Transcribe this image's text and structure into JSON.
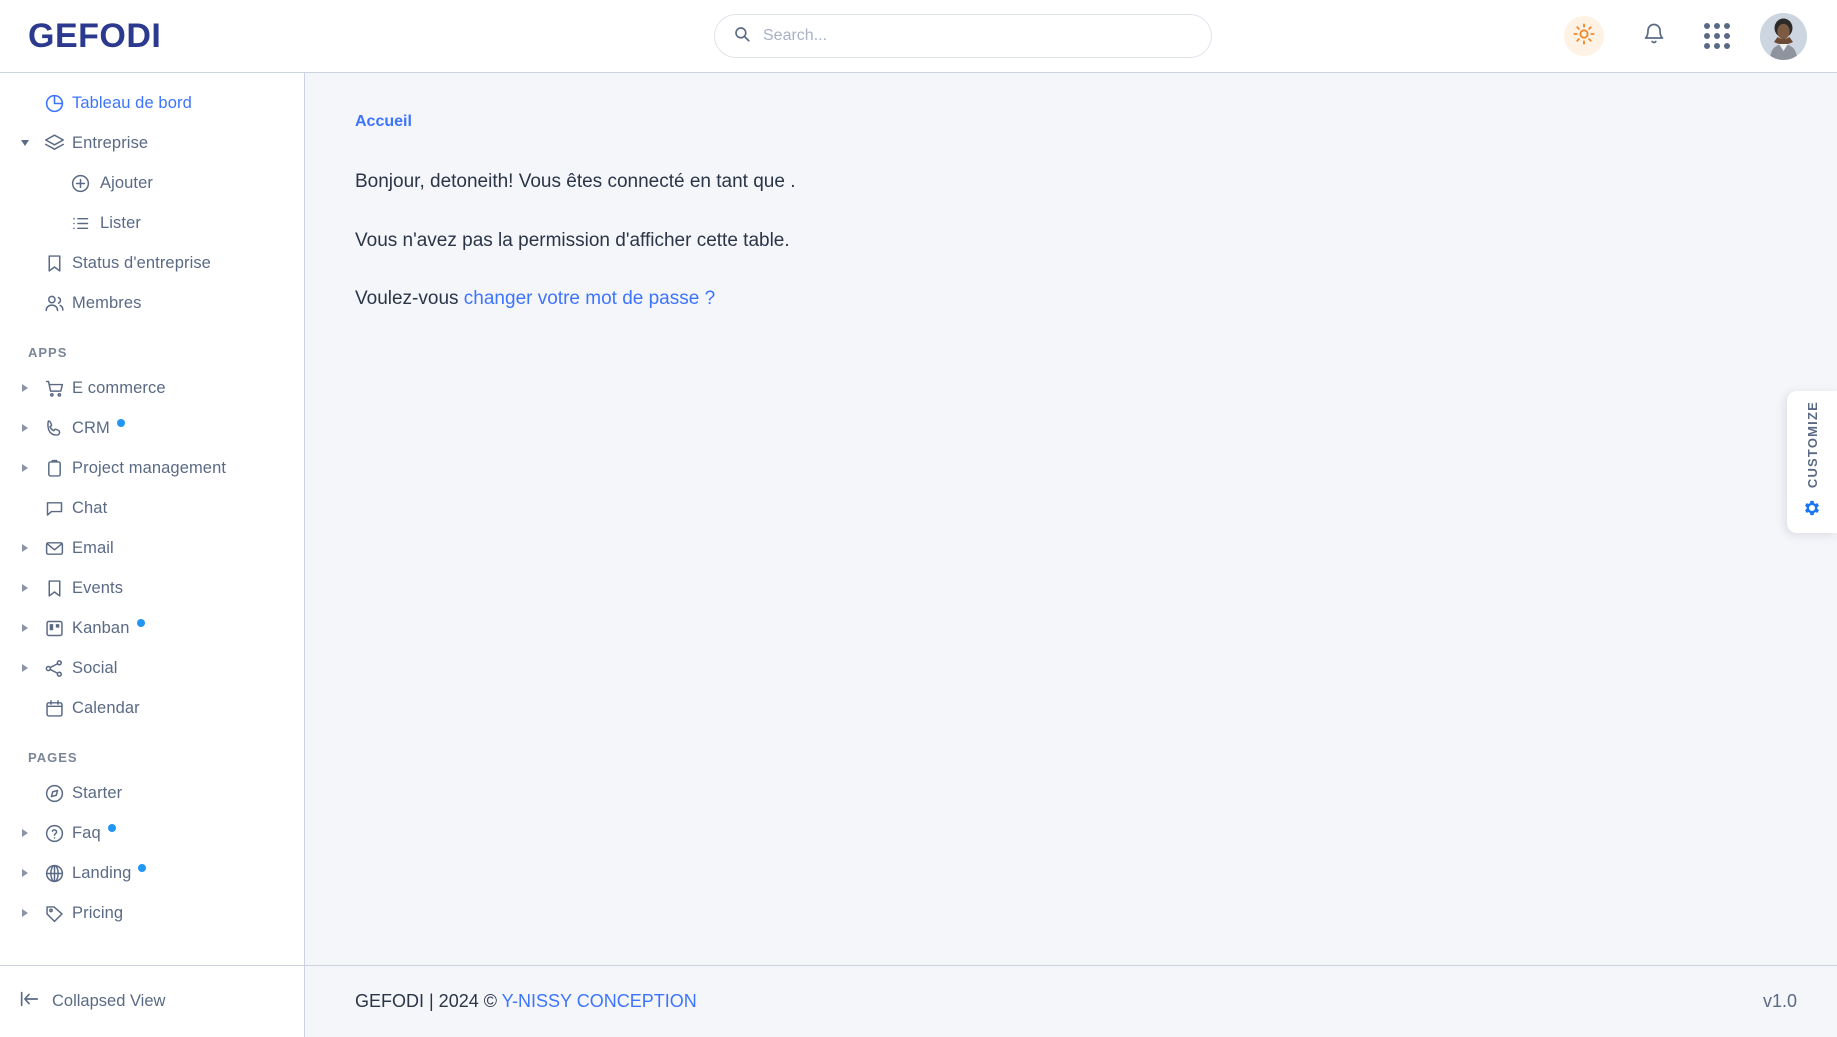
{
  "header": {
    "brand": "GEFODI",
    "search": {
      "placeholder": "Search...",
      "value": "",
      "icon": "search-icon"
    },
    "actions": [
      {
        "name": "theme-toggle-button",
        "icon": "sun-icon",
        "bg": "#fdf2e4",
        "color": "#f0872a"
      },
      {
        "name": "notifications-button",
        "icon": "bell-icon",
        "color": "#5a6a85"
      },
      {
        "name": "apps-grid-button",
        "icon": "apps-grid-icon",
        "color": "#5a6a85"
      },
      {
        "name": "profile-avatar",
        "icon": "avatar-icon"
      }
    ]
  },
  "sidebar": {
    "top_items": [
      {
        "label": "Tableau de bord",
        "icon": "pie-chart-icon",
        "active": true,
        "caret": "none",
        "dot": false,
        "sub": false
      },
      {
        "label": "Entreprise",
        "icon": "layers-icon",
        "active": false,
        "caret": "down",
        "dot": false,
        "sub": false
      },
      {
        "label": "Ajouter",
        "icon": "plus-circle-icon",
        "active": false,
        "caret": "none",
        "dot": false,
        "sub": true
      },
      {
        "label": "Lister",
        "icon": "list-icon",
        "active": false,
        "caret": "none",
        "dot": false,
        "sub": true
      },
      {
        "label": "Status d'entreprise",
        "icon": "bookmark-icon",
        "active": false,
        "caret": "none",
        "dot": false,
        "sub": false
      },
      {
        "label": "Membres",
        "icon": "users-icon",
        "active": false,
        "caret": "none",
        "dot": false,
        "sub": false
      }
    ],
    "apps_section_label": "APPS",
    "apps_items": [
      {
        "label": "E commerce",
        "icon": "shopping-cart-icon",
        "caret": "right",
        "dot": false
      },
      {
        "label": "CRM",
        "icon": "phone-icon",
        "caret": "right",
        "dot": true
      },
      {
        "label": "Project management",
        "icon": "clipboard-icon",
        "caret": "right",
        "dot": false
      },
      {
        "label": "Chat",
        "icon": "chat-bubble-icon",
        "caret": "none",
        "dot": false
      },
      {
        "label": "Email",
        "icon": "mail-icon",
        "caret": "right",
        "dot": false
      },
      {
        "label": "Events",
        "icon": "bookmark-icon",
        "caret": "right",
        "dot": false
      },
      {
        "label": "Kanban",
        "icon": "kanban-board-icon",
        "caret": "right",
        "dot": true
      },
      {
        "label": "Social",
        "icon": "share-icon",
        "caret": "right",
        "dot": false
      },
      {
        "label": "Calendar",
        "icon": "calendar-icon",
        "caret": "none",
        "dot": false
      }
    ],
    "pages_section_label": "PAGES",
    "pages_items": [
      {
        "label": "Starter",
        "icon": "compass-icon",
        "caret": "none",
        "dot": false
      },
      {
        "label": "Faq",
        "icon": "question-circle-icon",
        "caret": "right",
        "dot": true
      },
      {
        "label": "Landing",
        "icon": "globe-icon",
        "caret": "right",
        "dot": true
      },
      {
        "label": "Pricing",
        "icon": "tag-icon",
        "caret": "right",
        "dot": false
      }
    ],
    "collapse": {
      "label": "Collapsed View",
      "icon": "collapse-left-icon"
    }
  },
  "main": {
    "breadcrumb": "Accueil",
    "greeting": "Bonjour, detoneith! Vous êtes connecté en tant que .",
    "permission_message": "Vous n'avez pas la permission d'afficher cette table.",
    "password_prefix": "Voulez-vous ",
    "password_link": "changer votre mot de passe ?"
  },
  "customize": {
    "label": "CUSTOMIZE",
    "icon": "gear-icon",
    "color": "#1976f2"
  },
  "footer": {
    "copyright_prefix": "GEFODI | 2024 © ",
    "company_link": "Y-NISSY CONCEPTION",
    "version": "v1.0"
  },
  "colors": {
    "brand": "#2b3a8f",
    "accent": "#3d74ff",
    "text": "#2a3547",
    "muted": "#5a6a85",
    "content_bg": "#f5f6fa",
    "border": "#ccd2de",
    "badge_dot": "#2196f3"
  }
}
